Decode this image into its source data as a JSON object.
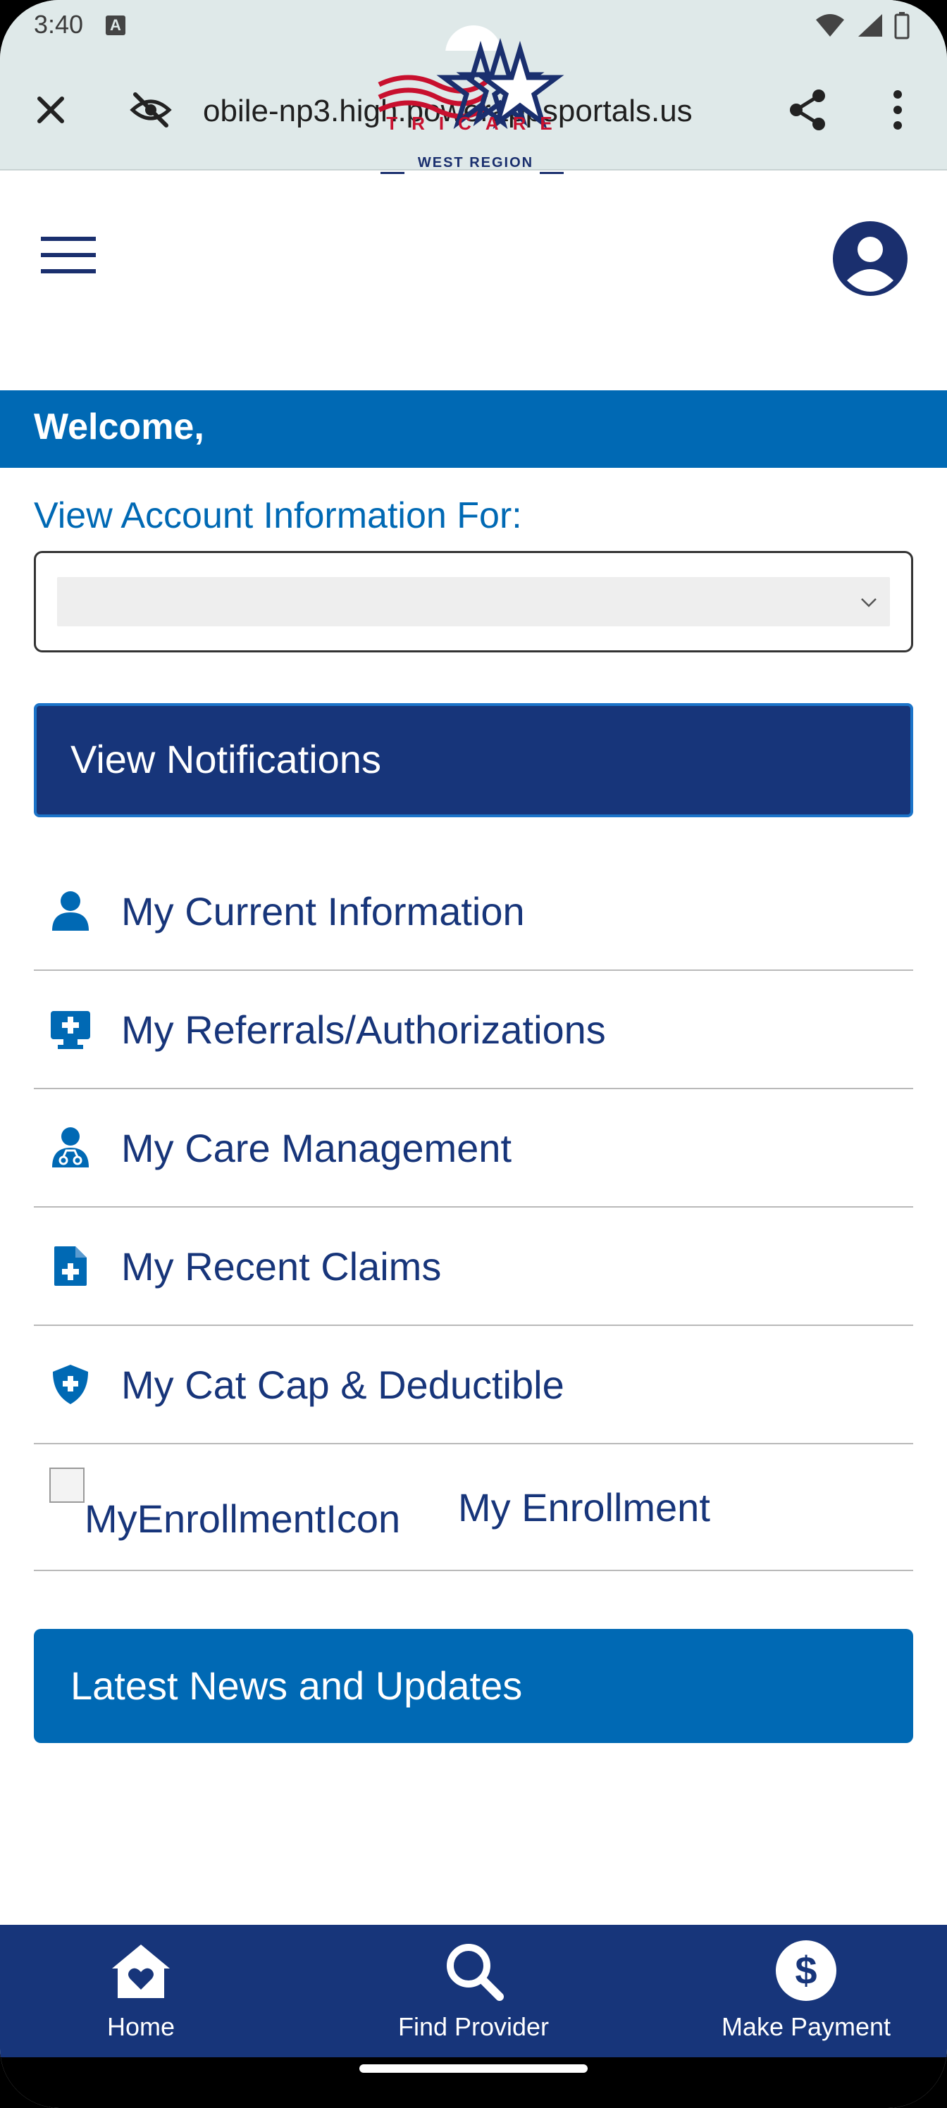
{
  "status_bar": {
    "time": "3:40",
    "notification_icon_letter": "A",
    "icons": [
      "wifi-icon",
      "signal-icon",
      "battery-icon"
    ]
  },
  "browser": {
    "url": "obile-np3.high.powerappsportals.us",
    "icons": [
      "close-icon",
      "eye-off-icon",
      "share-icon",
      "more-vert-icon"
    ]
  },
  "header": {
    "logo_text": "TRICARE",
    "logo_subtitle": "WEST REGION",
    "brand_colors": {
      "red": "#c8102e",
      "navy": "#1a2f6e"
    }
  },
  "welcome": {
    "text": "Welcome,",
    "background": "#0069b4"
  },
  "account": {
    "label": "View Account Information For:",
    "selected_value": ""
  },
  "notifications_button": {
    "label": "View Notifications",
    "background": "#17357a"
  },
  "menu": {
    "items": [
      {
        "label": "My Current Information",
        "icon": "person-icon"
      },
      {
        "label": "My Referrals/Authorizations",
        "icon": "medical-monitor-icon"
      },
      {
        "label": "My Care Management",
        "icon": "doctor-icon"
      },
      {
        "label": "My Recent Claims",
        "icon": "file-medical-icon"
      },
      {
        "label": "My Cat Cap & Deductible",
        "icon": "shield-plus-icon"
      },
      {
        "label": "My Enrollment",
        "icon_alt": "MyEnrollmentIcon"
      }
    ]
  },
  "news_button": {
    "label": "Latest News and Updates",
    "background": "#0069b4"
  },
  "bottom_nav": {
    "items": [
      {
        "label": "Home",
        "icon": "home-heart-icon"
      },
      {
        "label": "Find Provider",
        "icon": "search-icon"
      },
      {
        "label": "Make Payment",
        "icon": "dollar-circle-icon"
      }
    ]
  }
}
